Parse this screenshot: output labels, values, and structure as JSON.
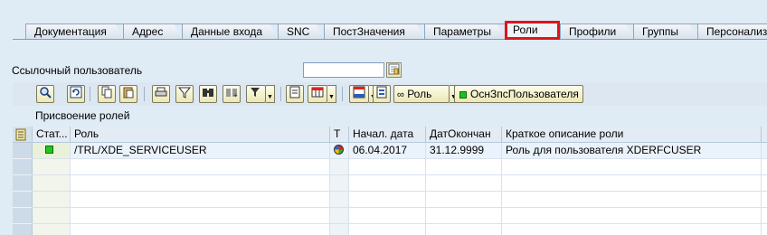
{
  "tabs": [
    {
      "label": "Документация",
      "active": false
    },
    {
      "label": "Адрес",
      "active": false
    },
    {
      "label": "Данные входа",
      "active": false
    },
    {
      "label": "SNC",
      "active": false
    },
    {
      "label": "ПостЗначения",
      "active": false
    },
    {
      "label": "Параметры",
      "active": false
    },
    {
      "label": "Роли",
      "active": true
    },
    {
      "label": "Профили",
      "active": false
    },
    {
      "label": "Группы",
      "active": false
    },
    {
      "label": "Персонализ",
      "active": false
    }
  ],
  "reference_user": {
    "label": "Ссылочный пользователь",
    "value": "",
    "f4_icon": "f4-help-icon"
  },
  "toolbar": {
    "icons": [
      "details-icon",
      "refresh-icon",
      "copy-icon",
      "paste-icon",
      "print-icon",
      "filter-icon",
      "find-icon",
      "find-next-icon",
      "filter-dropdown-icon",
      "print-preview-icon",
      "export-icon",
      "layout-icon",
      "detail-view-icon"
    ],
    "roles_button": "Роль",
    "base_user_button": "ОснЗпсПользователя"
  },
  "table": {
    "title": "Присвоение ролей",
    "columns": [
      "Стат...",
      "Роль",
      "T",
      "Начал. дата",
      "ДатОкончан",
      "Краткое описание роли"
    ],
    "rows": [
      {
        "status": "green",
        "role": "/TRL/XDE_SERVICEUSER",
        "type_icon": "composite-role-icon",
        "from": "06.04.2017",
        "to": "31.12.9999",
        "description": "Роль для пользователя XDERFCUSER"
      }
    ],
    "empty_rows": 5
  },
  "colors": {
    "background": "#dfebf5",
    "active_tab_border": "#e1141c",
    "status_green": "#22c322"
  }
}
